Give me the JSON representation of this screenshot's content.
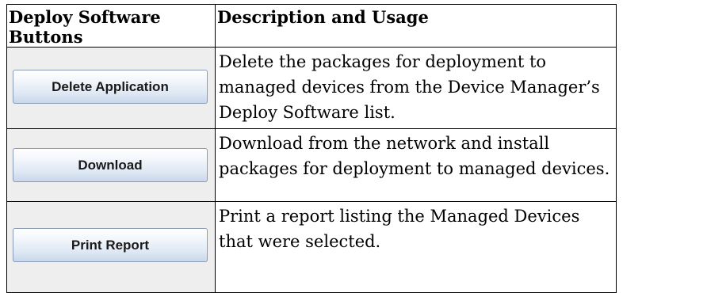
{
  "table": {
    "header": {
      "col1": "Deploy Software Buttons",
      "col2": "Description and Usage"
    },
    "rows": [
      {
        "button_label": "Delete Application",
        "description": "Delete the packages for deployment to managed devices from the Device Manager’s Deploy Software list."
      },
      {
        "button_label": "Download",
        "description": "Download from the network and install packages for deployment to managed devices."
      },
      {
        "button_label": "Print Report",
        "description": "Print a report listing the Managed Devices that were selected."
      }
    ]
  }
}
